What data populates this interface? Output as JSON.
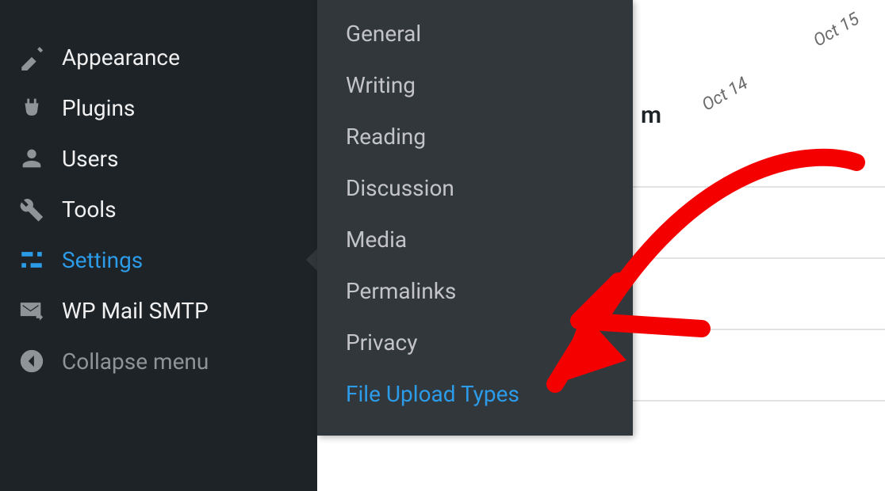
{
  "sidebar": {
    "items": [
      {
        "label": "Appearance",
        "icon": "appearance-icon"
      },
      {
        "label": "Plugins",
        "icon": "plugins-icon"
      },
      {
        "label": "Users",
        "icon": "users-icon"
      },
      {
        "label": "Tools",
        "icon": "tools-icon"
      },
      {
        "label": "Settings",
        "icon": "settings-icon",
        "active": true
      },
      {
        "label": "WP Mail SMTP",
        "icon": "wpmail-icon"
      },
      {
        "label": "Collapse menu",
        "icon": "collapse-icon",
        "collapse": true
      }
    ]
  },
  "submenu": {
    "items": [
      {
        "label": "General"
      },
      {
        "label": "Writing"
      },
      {
        "label": "Reading"
      },
      {
        "label": "Discussion"
      },
      {
        "label": "Media"
      },
      {
        "label": "Permalinks"
      },
      {
        "label": "Privacy"
      },
      {
        "label": "File Upload Types",
        "highlight": true
      }
    ]
  },
  "content": {
    "dates": [
      "Oct 14",
      "Oct 15"
    ],
    "partial_text": "m"
  }
}
